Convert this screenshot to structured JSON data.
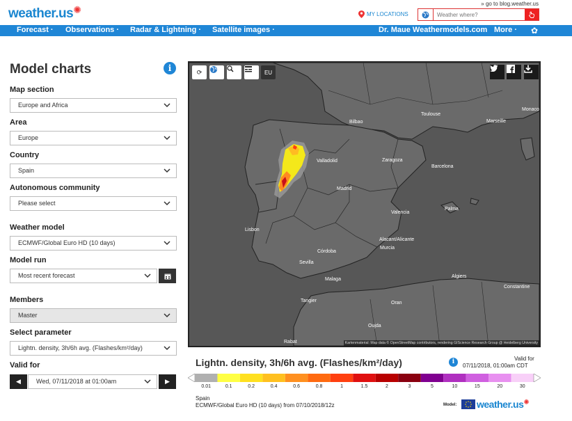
{
  "header": {
    "logo_text": "weather.us",
    "blog_link": "» go to blog.weather.us",
    "my_locations": "MY LOCATIONS",
    "search_placeholder": "Weather where?"
  },
  "nav": {
    "items": [
      "Forecast ·",
      "Observations ·",
      "Radar & Lightning ·",
      "Satellite images ·",
      "Dr. Maue Weathermodels.com",
      "More ·"
    ]
  },
  "sidebar": {
    "title": "Model charts",
    "fields": [
      {
        "label": "Map section",
        "value": "Europe and Africa"
      },
      {
        "label": "Area",
        "value": "Europe"
      },
      {
        "label": "Country",
        "value": "Spain"
      },
      {
        "label": "Autonomous community",
        "value": "Please select"
      },
      {
        "label": "Weather model",
        "value": "ECMWF/Global Euro HD (10 days)"
      },
      {
        "label": "Model run",
        "value": "Most recent forecast"
      },
      {
        "label": "Members",
        "value": "Master"
      },
      {
        "label": "Select parameter",
        "value": "Lightn. density, 3h/6h avg. (Flashes/km²/day)"
      },
      {
        "label": "Valid for",
        "value": "Wed, 07/11/2018 at 01:00am"
      }
    ]
  },
  "map": {
    "region_button": "EU",
    "tool_icons": [
      "refresh-icon",
      "globe-icon",
      "zoom-icon",
      "map-layers-icon"
    ],
    "share_icons": [
      "twitter-icon",
      "facebook-icon",
      "download-icon"
    ],
    "cities": [
      "Toulouse",
      "Marseille",
      "Monaco",
      "Bilbao",
      "Zaragoza",
      "Barcelona",
      "Valladolid",
      "Madrid",
      "Valencia",
      "Palma",
      "Lisbon",
      "Alacant/Alicante",
      "Murcia",
      "Córdoba",
      "Sevilla",
      "Malaga",
      "Algiers",
      "Constantine",
      "Tangier",
      "Oran",
      "Oujda",
      "Rabat"
    ],
    "attribution": "Kartenmaterial: Map data © OpenStreetMap contributors, rendering GIScience Research Group @ Heidelberg University"
  },
  "legend": {
    "title": "Lightn. density, 3h/6h avg. (Flashes/km²/day)",
    "valid_for_label": "Valid for",
    "valid_date": "07/11/2018, 01:00am CDT",
    "scale_labels": [
      "0.01",
      "0.1",
      "0.2",
      "0.4",
      "0.6",
      "0.8",
      "1",
      "1.5",
      "2",
      "3",
      "5",
      "10",
      "15",
      "20",
      "30"
    ],
    "scale_colors": [
      "#b0b0b0",
      "#ffff44",
      "#ffe020",
      "#ffc020",
      "#ff9020",
      "#ff6a10",
      "#ff4010",
      "#e01010",
      "#b80000",
      "#8a0010",
      "#800090",
      "#b030c0",
      "#d060e0",
      "#e890f0",
      "#f8d0f8"
    ],
    "region": "Spain",
    "model_line": "ECMWF/Global Euro HD (10 days)  from 07/10/2018/12z",
    "model_label": "Model:",
    "logo_text": "weather.us"
  }
}
